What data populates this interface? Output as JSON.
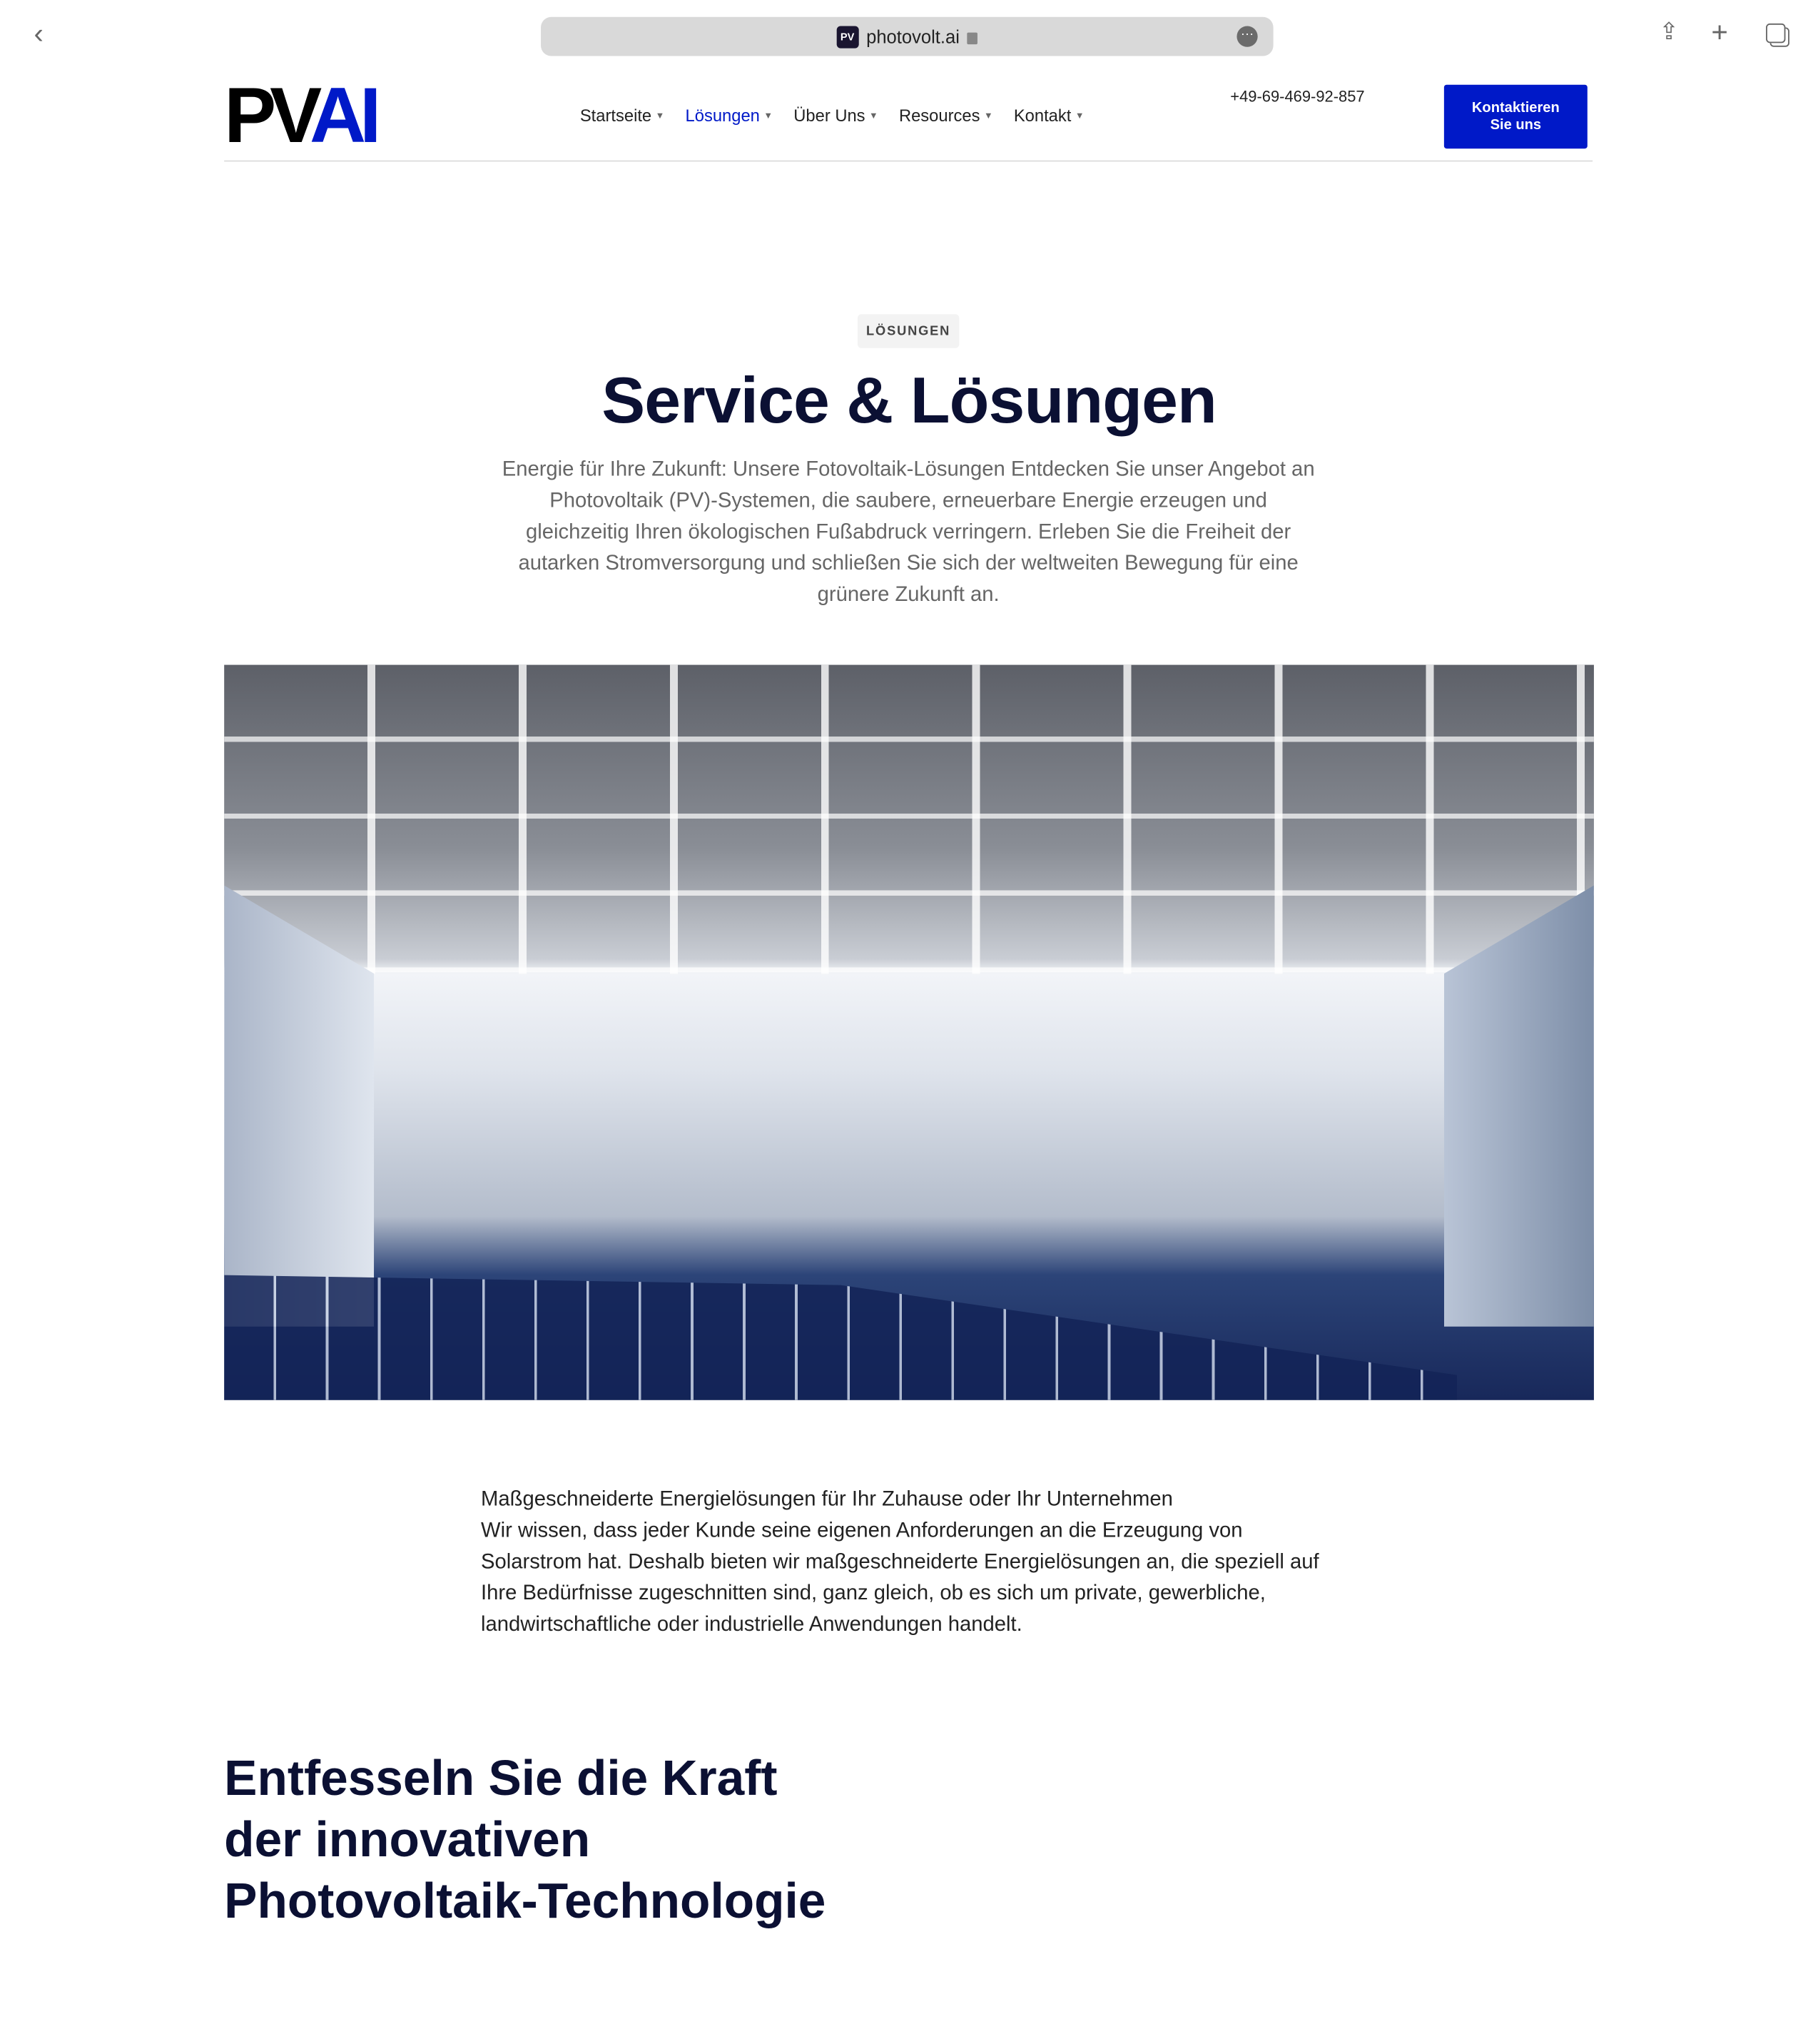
{
  "browser": {
    "url": "photovolt.ai",
    "favicon_text": "PV",
    "icons": [
      "back-chevron-icon",
      "lock-icon",
      "more-icon",
      "share-icon",
      "plus-icon",
      "tabs-icon"
    ]
  },
  "header": {
    "logo": {
      "text_black": "PV",
      "text_blue": "AI"
    },
    "nav": [
      {
        "label": "Startseite"
      },
      {
        "label": "Lösungen",
        "active": true
      },
      {
        "label": "Über Uns"
      },
      {
        "label": "Resources"
      },
      {
        "label": "Kontakt"
      }
    ],
    "phone": "+49-69-469-92-857",
    "cta_line1": "Kontaktieren",
    "cta_line2": "Sie uns"
  },
  "colors": {
    "accent": "#0019c8",
    "heading": "#0b1033"
  },
  "hero": {
    "badge": "LÖSUNGEN",
    "title": "Service & Lösungen",
    "lead": "Energie für Ihre Zukunft: Unsere Fotovoltaik-Lösungen Entdecken Sie unser Angebot an Photovoltaik (PV)-Systemen, die saubere, erneuerbare Energie erzeugen und gleichzeitig Ihren ökologischen Fußabdruck verringern. Erleben Sie die Freiheit der autarken Stromversorgung und schließen Sie sich der weltweiten Bewegung für eine grünere Zukunft an."
  },
  "intro": {
    "line1": "Maßgeschneiderte Energielösungen für Ihr Zuhause oder Ihr Unternehmen",
    "text": "Wir wissen, dass jeder Kunde seine eigenen Anforderungen an die Erzeugung von Solarstrom hat. Deshalb bieten wir maßgeschneiderte Energielösungen an, die speziell auf Ihre Bedürfnisse zugeschnitten sind, ganz gleich, ob es sich um private, gewerbliche, landwirtschaftliche oder industrielle Anwendungen handelt."
  },
  "section": {
    "heading": "Entfesseln Sie die Kraft der innovativen Photovoltaik-Technologie"
  }
}
